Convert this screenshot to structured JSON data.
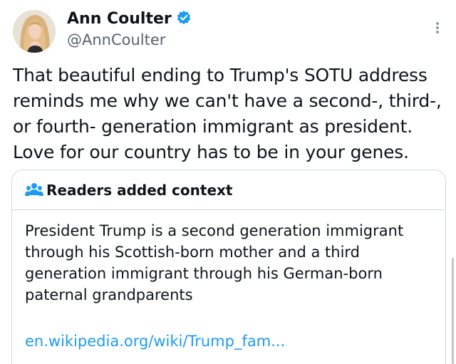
{
  "author": {
    "name": "Ann Coulter",
    "handle": "@AnnCoulter",
    "verified": true,
    "avatar_icon": "profile-photo",
    "verified_icon": "verified-badge-icon",
    "verified_color": "#1d9bf0"
  },
  "tweet": {
    "text": "That beautiful ending to Trump's SOTU address\nreminds me why we can't have a second-, third-,\nor fourth- generation immigrant as president.\nLove for our country has to be in your genes."
  },
  "more_menu_icon": "more-vertical-icon",
  "community_note": {
    "icon": "people-icon",
    "icon_color": "#1d9bf0",
    "title": "Readers added context",
    "body": "President Trump is a second generation immigrant through his Scottish-born mother and a third generation immigrant through his German-born paternal grandparents",
    "link_text": "en.wikipedia.org/wiki/Trump_fam...",
    "link_color": "#1d9bf0"
  }
}
